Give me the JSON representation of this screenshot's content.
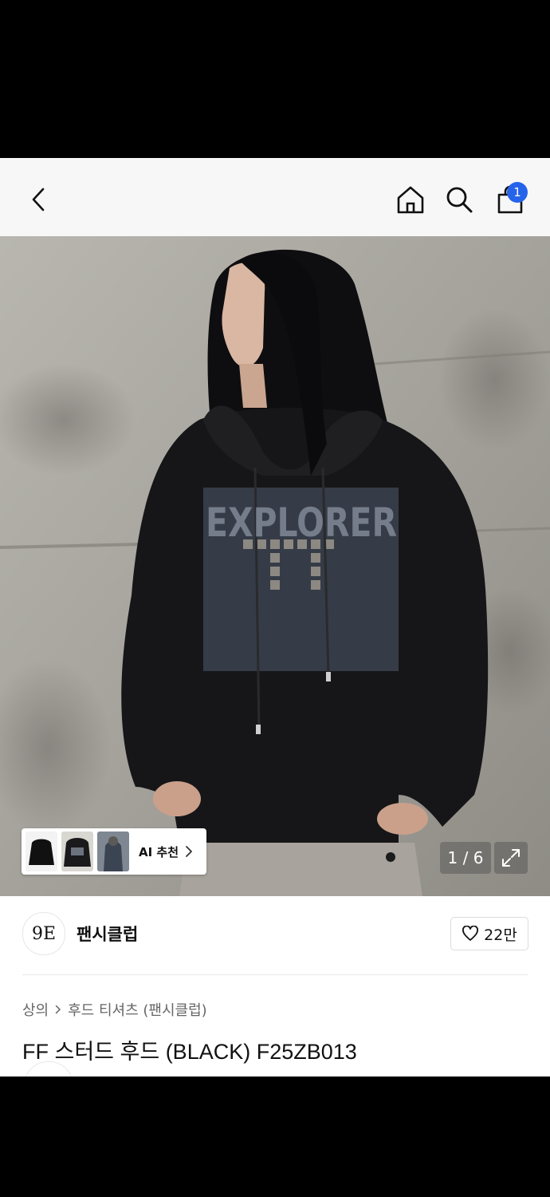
{
  "header": {
    "cart_badge": "1"
  },
  "gallery": {
    "ai_label": "AI 추천",
    "counter": "1 / 6",
    "current": 1,
    "total": 6
  },
  "brand": {
    "logo_text": "9E",
    "name": "팬시클럽",
    "likes": "22만"
  },
  "breadcrumb": {
    "level1": "상의",
    "level2": "후드 티셔츠 (팬시클럽)"
  },
  "product": {
    "title": "FF 스터드 후드 (BLACK) F25ZB013"
  },
  "hoodie_print": "EXPLORER",
  "colors": {
    "badge": "#2563eb",
    "header_bg": "#f7f7f7"
  }
}
